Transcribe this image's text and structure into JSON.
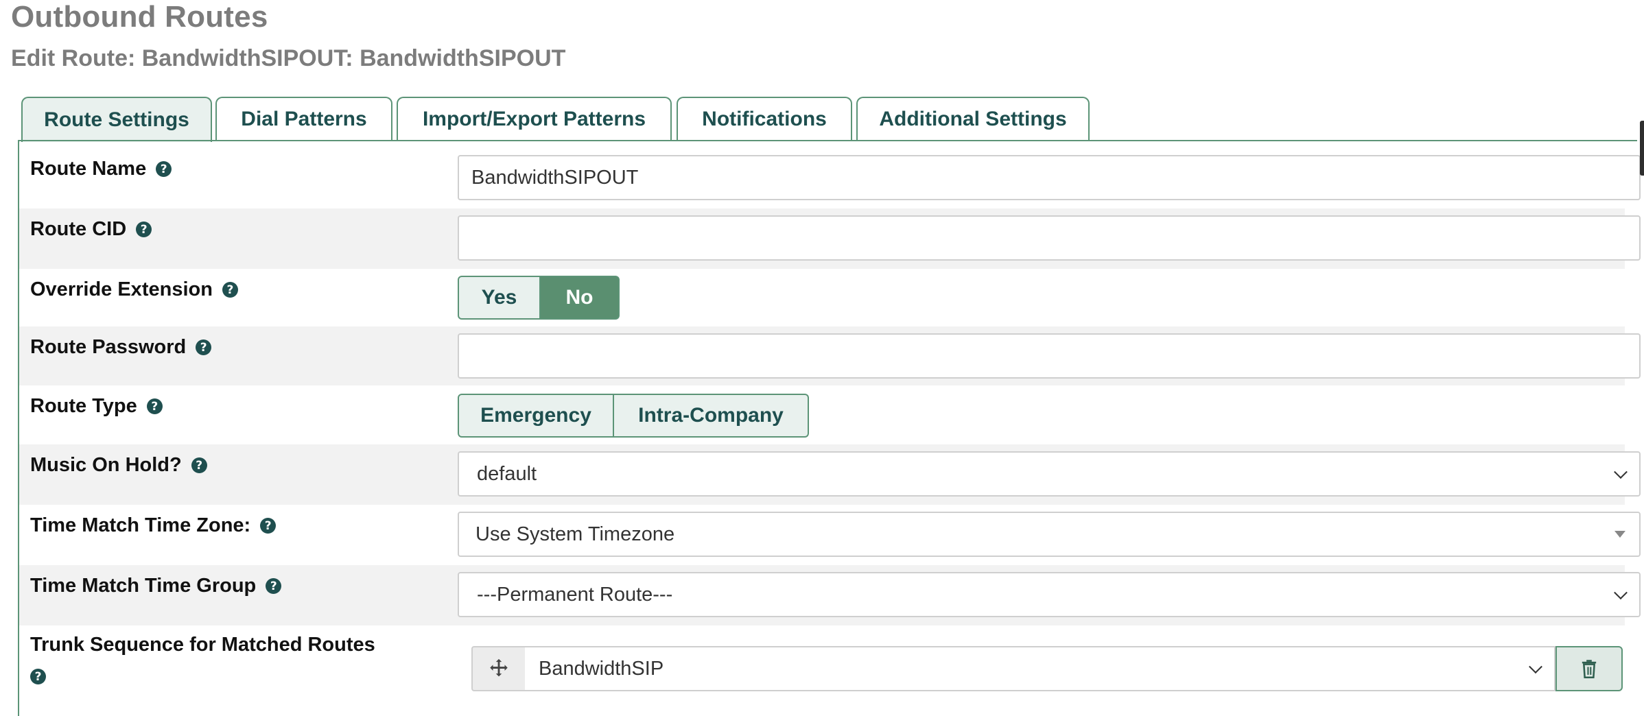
{
  "page": {
    "title": "Outbound Routes",
    "subtitle": "Edit Route: BandwidthSIPOUT: BandwidthSIPOUT"
  },
  "tabs": [
    {
      "label": "Route Settings",
      "active": true
    },
    {
      "label": "Dial Patterns",
      "active": false
    },
    {
      "label": "Import/Export Patterns",
      "active": false
    },
    {
      "label": "Notifications",
      "active": false
    },
    {
      "label": "Additional Settings",
      "active": false
    }
  ],
  "help_glyph": "?",
  "fields": {
    "route_name": {
      "label": "Route Name",
      "value": "BandwidthSIPOUT"
    },
    "route_cid": {
      "label": "Route CID",
      "value": ""
    },
    "override_extension": {
      "label": "Override Extension",
      "options": [
        "Yes",
        "No"
      ],
      "selected": "No"
    },
    "route_password": {
      "label": "Route Password",
      "value": ""
    },
    "route_type": {
      "label": "Route Type",
      "options": [
        "Emergency",
        "Intra-Company"
      ]
    },
    "music_on_hold": {
      "label": "Music On Hold?",
      "value": "default"
    },
    "time_zone": {
      "label": "Time Match Time Zone:",
      "value": "Use System Timezone"
    },
    "time_group": {
      "label": "Time Match Time Group",
      "value": "---Permanent Route---"
    },
    "trunk_sequence": {
      "label": "Trunk Sequence for Matched Routes",
      "value": "BandwidthSIP"
    }
  },
  "colors": {
    "accent": "#5a8f70",
    "tab_text": "#1e4f4f",
    "title_gray": "#7c7c7c"
  }
}
